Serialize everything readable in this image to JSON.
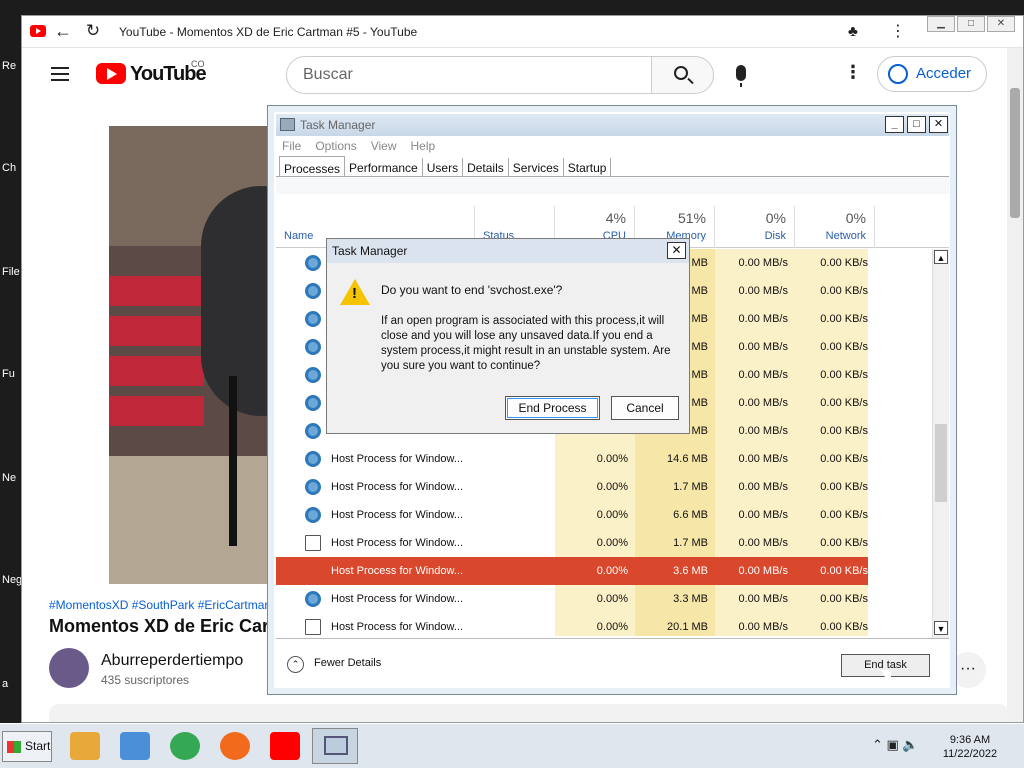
{
  "desktop": {
    "labels": [
      "Re",
      "Ch",
      "File",
      "Fu",
      "Ne",
      "Neg",
      "a"
    ]
  },
  "browser": {
    "tab_title": "YouTube - Momentos XD de Eric Cartman #5 - YouTube",
    "window_buttons": [
      "▁",
      "□",
      "✕"
    ]
  },
  "youtube": {
    "logo_text": "YouTube",
    "country_code": "CO",
    "search_placeholder": "Buscar",
    "signin_label": "Acceder",
    "hashtags": "#MomentosXD #SouthPark #EricCartman",
    "video_title": "Momentos XD de Eric Cartman",
    "channel_name": "Aburreperdertiempo",
    "subscribers": "435 suscriptores",
    "more": "···"
  },
  "task_manager": {
    "title": "Task Manager",
    "menu": [
      "File",
      "Options",
      "View",
      "Help"
    ],
    "tabs": [
      "Processes",
      "Performance",
      "Users",
      "Details",
      "Services",
      "Startup"
    ],
    "active_tab": "Processes",
    "columns": {
      "name": "Name",
      "status": "Status",
      "cpu_pct": "4%",
      "cpu": "CPU",
      "memory_pct": "51%",
      "memory": "Memory",
      "disk_pct": "0%",
      "disk": "Disk",
      "network_pct": "0%",
      "network": "Network"
    },
    "rows": [
      {
        "name": "",
        "cpu": "",
        "mem": "MB",
        "disk": "0.00 MB/s",
        "net": "0.00 KB/s",
        "icon": "gear-icon"
      },
      {
        "name": "",
        "cpu": "",
        "mem": "MB",
        "disk": "0.00 MB/s",
        "net": "0.00 KB/s",
        "icon": "gear-icon"
      },
      {
        "name": "",
        "cpu": "",
        "mem": "MB",
        "disk": "0.00 MB/s",
        "net": "0.00 KB/s",
        "icon": "gear-icon"
      },
      {
        "name": "",
        "cpu": "",
        "mem": "MB",
        "disk": "0.00 MB/s",
        "net": "0.00 KB/s",
        "icon": "gear-icon"
      },
      {
        "name": "",
        "cpu": "",
        "mem": "MB",
        "disk": "0.00 MB/s",
        "net": "0.00 KB/s",
        "icon": "gear-icon"
      },
      {
        "name": "",
        "cpu": "",
        "mem": "MB",
        "disk": "0.00 MB/s",
        "net": "0.00 KB/s",
        "icon": "gear-icon"
      },
      {
        "name": "Host Process for Window...",
        "cpu": "0.00%",
        "mem": "MB",
        "disk": "0.00 MB/s",
        "net": "0.00 KB/s",
        "icon": "gear-icon"
      },
      {
        "name": "Host Process for Window...",
        "cpu": "0.00%",
        "mem": "14.6 MB",
        "disk": "0.00 MB/s",
        "net": "0.00 KB/s",
        "icon": "gear-icon"
      },
      {
        "name": "Host Process for Window...",
        "cpu": "0.00%",
        "mem": "1.7 MB",
        "disk": "0.00 MB/s",
        "net": "0.00 KB/s",
        "icon": "gear-icon"
      },
      {
        "name": "Host Process for Window...",
        "cpu": "0.00%",
        "mem": "6.6 MB",
        "disk": "0.00 MB/s",
        "net": "0.00 KB/s",
        "icon": "gear-icon"
      },
      {
        "name": "Host Process for Window...",
        "cpu": "0.00%",
        "mem": "1.7 MB",
        "disk": "0.00 MB/s",
        "net": "0.00 KB/s",
        "icon": "window-icon"
      },
      {
        "name": "Host Process for Window...",
        "cpu": "0.00%",
        "mem": "3.6 MB",
        "disk": "0.00 MB/s",
        "net": "0.00 KB/s",
        "icon": "gear-icon",
        "selected": true
      },
      {
        "name": "Host Process for Window...",
        "cpu": "0.00%",
        "mem": "3.3 MB",
        "disk": "0.00 MB/s",
        "net": "0.00 KB/s",
        "icon": "gear-icon"
      },
      {
        "name": "Host Process for Window...",
        "cpu": "0.00%",
        "mem": "20.1 MB",
        "disk": "0.00 MB/s",
        "net": "0.00 KB/s",
        "icon": "window-icon"
      }
    ],
    "fewer_details": "Fewer Details",
    "end_task": "End task"
  },
  "dialog": {
    "title": "Task Manager",
    "question": "Do you want to end 'svchost.exe'?",
    "message": "If an open program is associated with this process,it will close and you will lose any unsaved data.If you end a system process,it might result in an unstable system. Are you sure you want to continue?",
    "end_process": "End Process",
    "cancel": "Cancel"
  },
  "taskbar": {
    "start": "Start",
    "time": "9:36 AM",
    "date": "11/22/2022",
    "app_colors": [
      "#e8a93a",
      "#4a8fd8",
      "#34a853",
      "#f26a1b",
      "#ff0000"
    ]
  }
}
